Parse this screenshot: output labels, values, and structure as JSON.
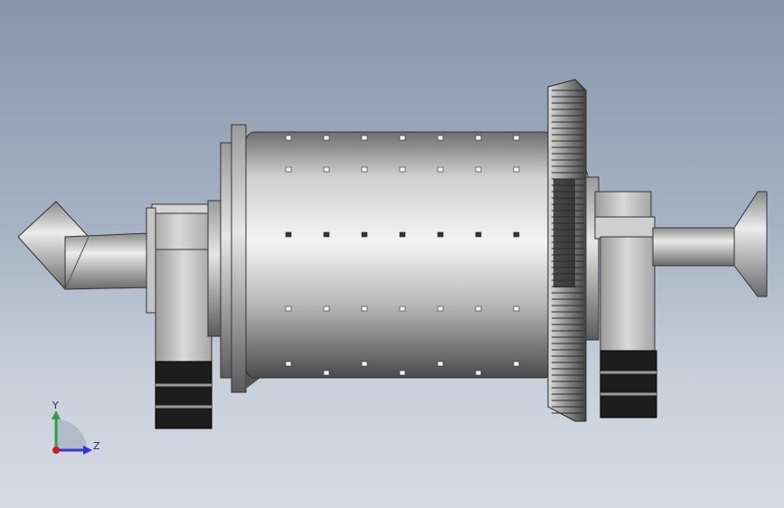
{
  "viewport": {
    "background_top": "#8796ab",
    "background_bottom": "#d6dbe3"
  },
  "model": {
    "body_color": "#b9b9b9",
    "dark_color": "#1a1a1a",
    "bolt_color": "#f2f2f2"
  },
  "triad": {
    "y_label": "Y",
    "z_label": "Z",
    "y_color": "#2ea043",
    "z_color": "#2d3bd1",
    "x_color": "#d11a1a",
    "icon": "coordinate-triad-icon"
  }
}
